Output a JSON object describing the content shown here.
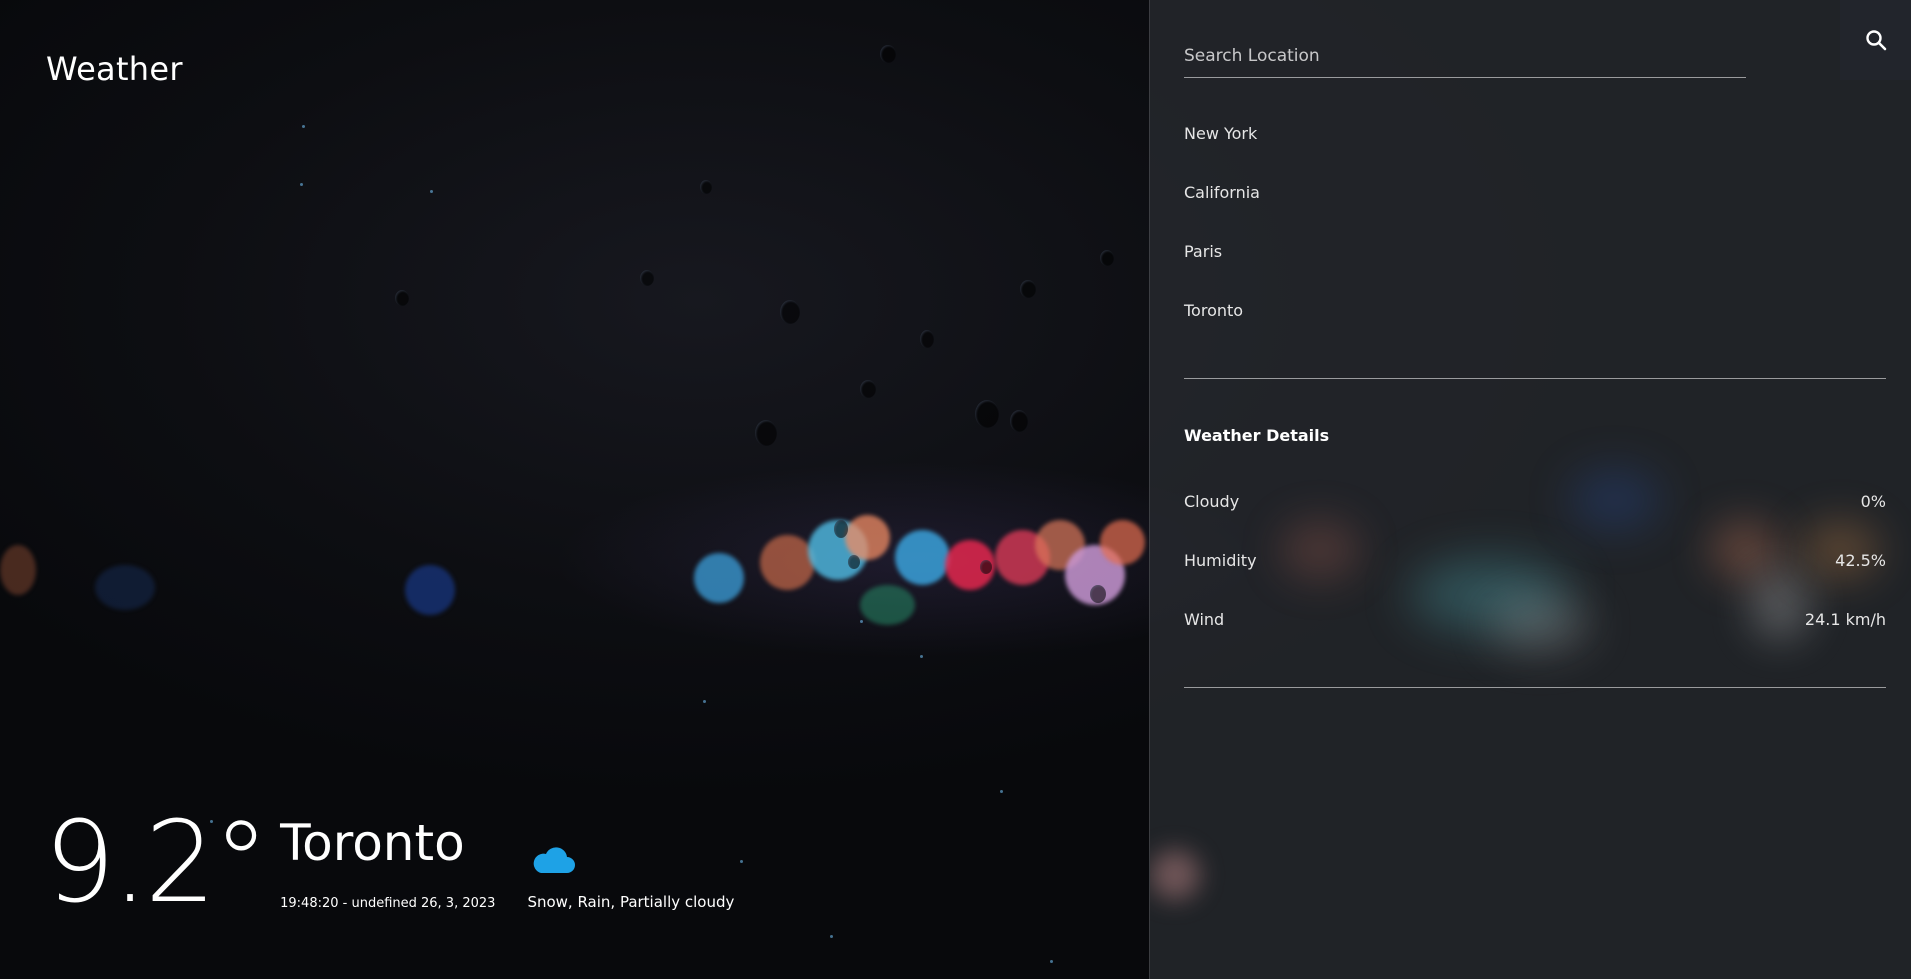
{
  "app": {
    "title": "Weather"
  },
  "current": {
    "temperature": "9.2°",
    "city": "Toronto",
    "datetime": "19:48:20 - undefined 26, 3, 2023",
    "condition": "Snow, Rain, Partially cloudy",
    "condition_icon": "cloud-icon"
  },
  "search": {
    "placeholder": "Search Location",
    "value": "",
    "button_icon": "search-icon"
  },
  "locations": [
    "New York",
    "California",
    "Paris",
    "Toronto"
  ],
  "details": {
    "title": "Weather Details",
    "items": [
      {
        "label": "Cloudy",
        "value": "0%"
      },
      {
        "label": "Humidity",
        "value": "42.5%"
      },
      {
        "label": "Wind",
        "value": "24.1 km/h"
      }
    ]
  },
  "colors": {
    "accent_cloud": "#1ea2e6",
    "panel_bg": "#2a2c31",
    "text": "#ffffff"
  }
}
